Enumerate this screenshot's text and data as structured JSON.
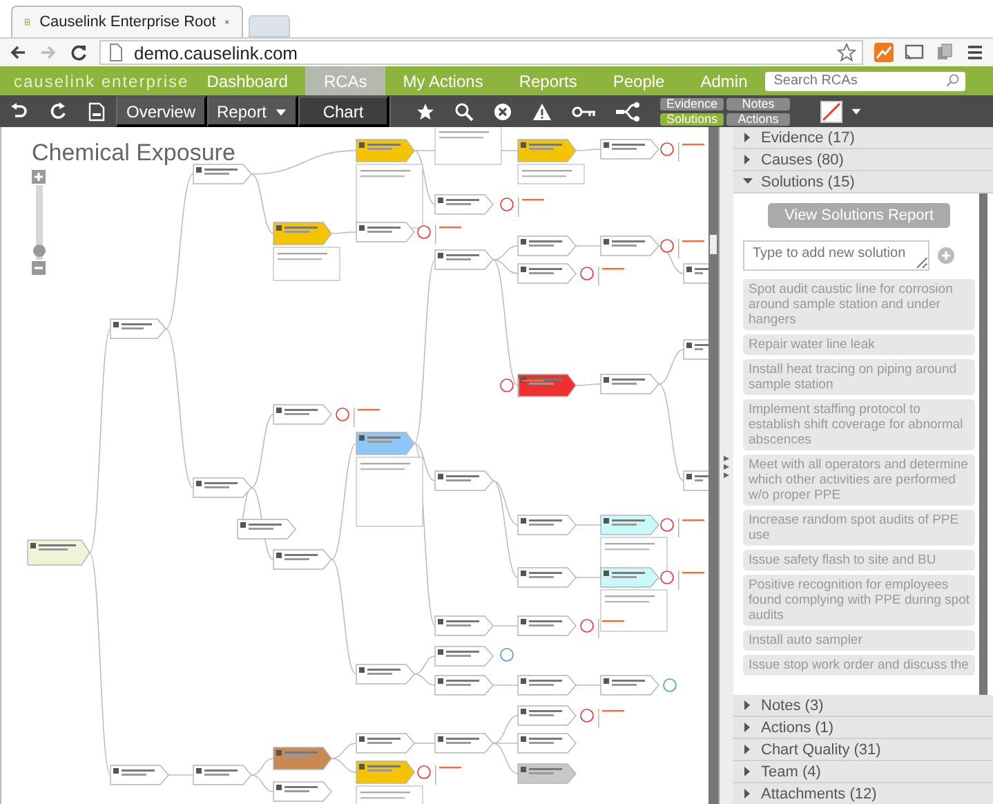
{
  "browser": {
    "tab_title": "Causelink Enterprise Root",
    "url": "demo.causelink.com"
  },
  "nav": {
    "logo": "causelink enterprise",
    "items": [
      {
        "label": "Dashboard",
        "selected": false
      },
      {
        "label": "RCAs",
        "selected": true
      },
      {
        "label": "My Actions",
        "selected": false
      },
      {
        "label": "Reports",
        "selected": false
      },
      {
        "label": "People",
        "selected": false
      },
      {
        "label": "Admin",
        "selected": false
      }
    ],
    "search": {
      "placeholder": "Search RCAs"
    }
  },
  "toolbar": {
    "views": [
      {
        "label": "Overview",
        "kind": "plain",
        "selected": false
      },
      {
        "label": "Report",
        "kind": "dropdown",
        "selected": false
      },
      {
        "label": "Chart",
        "kind": "plain",
        "selected": true
      }
    ],
    "panel_tabs": [
      {
        "label": "Evidence",
        "selected": false
      },
      {
        "label": "Notes",
        "selected": false
      },
      {
        "label": "Solutions",
        "selected": true
      },
      {
        "label": "Actions",
        "selected": false
      }
    ]
  },
  "chart": {
    "title": "Chemical Exposure",
    "zoom": {
      "level": 0.05
    }
  },
  "panel": {
    "sections": [
      {
        "label": "Evidence (17)",
        "expanded": false
      },
      {
        "label": "Causes (80)",
        "expanded": false
      },
      {
        "label": "Solutions (15)",
        "expanded": true
      },
      {
        "label": "Notes (3)",
        "expanded": false
      },
      {
        "label": "Actions (1)",
        "expanded": false
      },
      {
        "label": "Chart Quality (31)",
        "expanded": false
      },
      {
        "label": "Team (4)",
        "expanded": false
      },
      {
        "label": "Attachments (12)",
        "expanded": false
      }
    ],
    "solutions": {
      "report_button": "View Solutions Report",
      "new_placeholder": "Type to add new solution",
      "items": [
        "Spot audit caustic line for corrosion around sample station and under hangers",
        "Repair water line leak",
        "Install heat tracing on piping around sample station",
        "Implement staffing protocol to establish shift coverage for abnormal abscences",
        "Meet with all operators and determine which other activities are performed w/o proper PPE",
        "Increase random spot audits of PPE use",
        "Issue safety flash to site and BU",
        "Positive recognition for employees found complying with PPE during spot audits",
        "Install auto sampler",
        "Issue stop work order and discuss the"
      ]
    }
  }
}
